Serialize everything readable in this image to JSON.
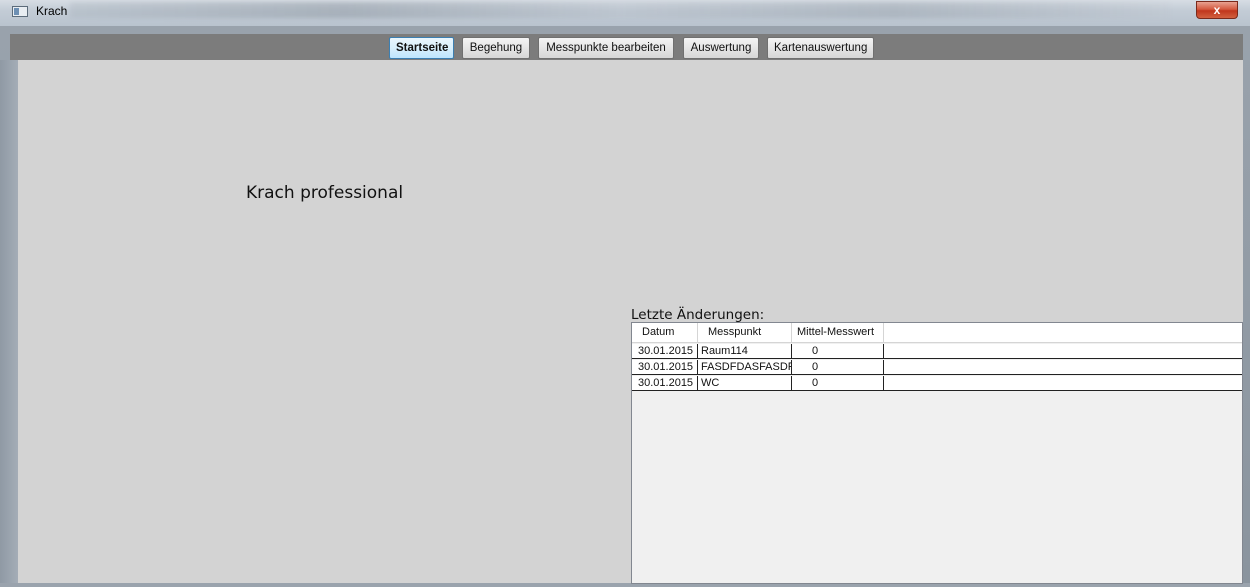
{
  "window": {
    "title": "Krach",
    "close_glyph": "x"
  },
  "nav": {
    "items": [
      {
        "label": "Startseite",
        "active": true
      },
      {
        "label": "Begehung",
        "active": false
      },
      {
        "label": "Messpunkte bearbeiten",
        "active": false
      },
      {
        "label": "Auswertung",
        "active": false
      },
      {
        "label": "Kartenauswertung",
        "active": false
      }
    ]
  },
  "main": {
    "app_heading": "Krach professional",
    "changes_label": "Letzte Änderungen:",
    "table": {
      "columns": [
        "Datum",
        "Messpunkt",
        "Mittel-Messwert"
      ],
      "rows": [
        [
          "30.01.2015",
          "Raum114",
          "0"
        ],
        [
          "30.01.2015",
          "FASDFDASFASDF",
          "0"
        ],
        [
          "30.01.2015",
          "WC",
          "0"
        ]
      ]
    }
  },
  "icons": {
    "app": "window-app-icon",
    "close": "close-icon"
  },
  "colors": {
    "background": "#d3d3d3",
    "toolbar": "#7c7c7c",
    "active_button_border": "#3c7fb1",
    "close_button": "#c0361d"
  }
}
